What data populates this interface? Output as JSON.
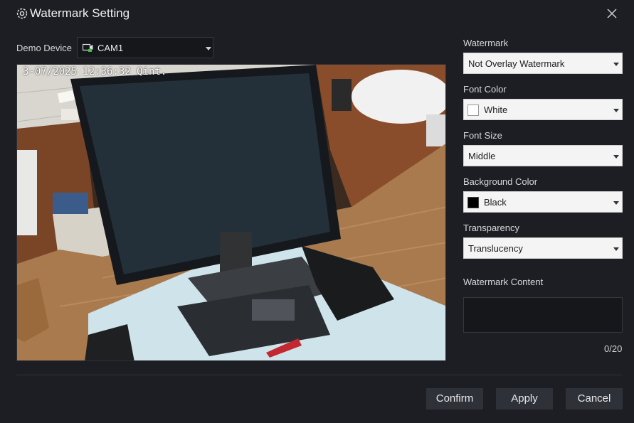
{
  "dialog": {
    "title": "Watermark Setting",
    "close_icon": "close-icon",
    "settings_icon": "gear-icon"
  },
  "demo": {
    "label": "Demo Device",
    "device_value": "CAM1",
    "device_icon": "camera-icon"
  },
  "preview": {
    "osd_text": "3-07/2025 12:36:32 Qint."
  },
  "fields": {
    "watermark": {
      "label": "Watermark",
      "value": "Not Overlay Watermark"
    },
    "font_color": {
      "label": "Font Color",
      "value": "White",
      "swatch": "#ffffff"
    },
    "font_size": {
      "label": "Font Size",
      "value": "Middle"
    },
    "background_color": {
      "label": "Background Color",
      "value": "Black",
      "swatch": "#000000"
    },
    "transparency": {
      "label": "Transparency",
      "value": "Translucency"
    },
    "content": {
      "label": "Watermark Content",
      "value": "",
      "counter": "0/20"
    }
  },
  "buttons": {
    "confirm": "Confirm",
    "apply": "Apply",
    "cancel": "Cancel"
  },
  "colors": {
    "background": "#1c1e23",
    "input_dark": "#15171b",
    "button": "#2e3138"
  }
}
